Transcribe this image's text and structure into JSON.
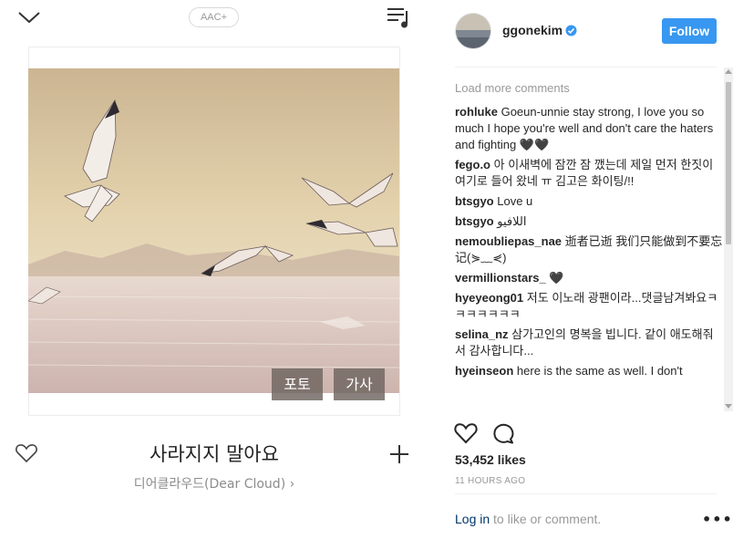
{
  "player": {
    "aac_badge": "AAC+",
    "buttons": {
      "photo": "포토",
      "lyrics": "가사"
    },
    "song_title": "사라지지 말아요",
    "artist": "디어클라우드(Dear Cloud) ›",
    "icons": {
      "collapse": "chevron-down-icon",
      "playlist": "playlist-icon",
      "like": "heart-outline-icon",
      "add": "plus-icon"
    }
  },
  "post": {
    "username": "ggonekim",
    "verified": true,
    "follow_label": "Follow",
    "load_more": "Load more comments",
    "comments": [
      {
        "user": "rohluke",
        "text": "Goeun-unnie stay strong, I love you so much I hope you're well and don't care the haters and fighting 🖤🖤"
      },
      {
        "user": "fego.o",
        "text": "아 이새벽에 잠깐 잠 깼는데 제일 먼저 한짓이 여기로 들어 왔네 ㅠ 김고은 화이팅/!!"
      },
      {
        "user": "btsgyo",
        "text": "Love u"
      },
      {
        "user": "btsgyo",
        "text": "اللافيو"
      },
      {
        "user": "nemoubliepas_nae",
        "text": "逝者已逝 我们只能做到不要忘记(⋟﹏⋞)"
      },
      {
        "user": "vermillionstars_",
        "text": "🖤"
      },
      {
        "user": "hyeyeong01",
        "text": "저도 이노래 광팬이라...댓글남겨봐요ㅋㅋㅋㅋㅋㅋㅋ"
      },
      {
        "user": "selina_nz",
        "text": "삼가고인의 명복을 빕니다. 같이 애도해줘서 감사합니다..."
      },
      {
        "user": "hyeinseon",
        "text": "here is the same as well. I don't"
      }
    ],
    "likes": "53,452 likes",
    "time_ago": "11 HOURS AGO",
    "login_link": "Log in",
    "login_rest": " to like or comment.",
    "more": "•••",
    "colors": {
      "follow_bg": "#3897f0",
      "link": "#003569",
      "muted": "#999999"
    }
  }
}
